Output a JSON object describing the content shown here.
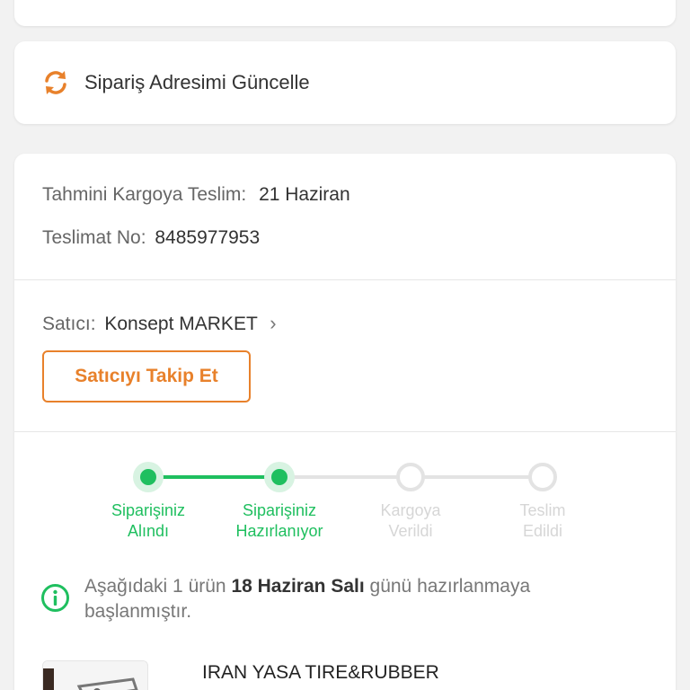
{
  "address_card": {
    "label": "Sipariş Adresimi Güncelle",
    "icon": "refresh-icon"
  },
  "delivery": {
    "estimate_label": "Tahmini Kargoya Teslim:",
    "estimate_value": "21 Haziran",
    "number_label": "Teslimat No:",
    "number_value": "8485977953"
  },
  "seller": {
    "label": "Satıcı:",
    "name": "Konsept MARKET",
    "follow_button": "Satıcıyı Takip Et"
  },
  "progress": {
    "steps": [
      {
        "line1": "Siparişiniz",
        "line2": "Alındı",
        "state": "done"
      },
      {
        "line1": "Siparişiniz",
        "line2": "Hazırlanıyor",
        "state": "done"
      },
      {
        "line1": "Kargoya",
        "line2": "Verildi",
        "state": "pending"
      },
      {
        "line1": "Teslim",
        "line2": "Edildi",
        "state": "pending"
      }
    ]
  },
  "info": {
    "prefix": "Aşağıdaki 1 ürün ",
    "date": "18 Haziran Salı",
    "suffix": " günü hazırlanmaya başlanmıştır."
  },
  "product": {
    "title": "IRAN YASA TIRE&RUBBER"
  },
  "colors": {
    "accent": "#e8812b",
    "success": "#1fbf5f",
    "pending": "#e3e3e3"
  }
}
